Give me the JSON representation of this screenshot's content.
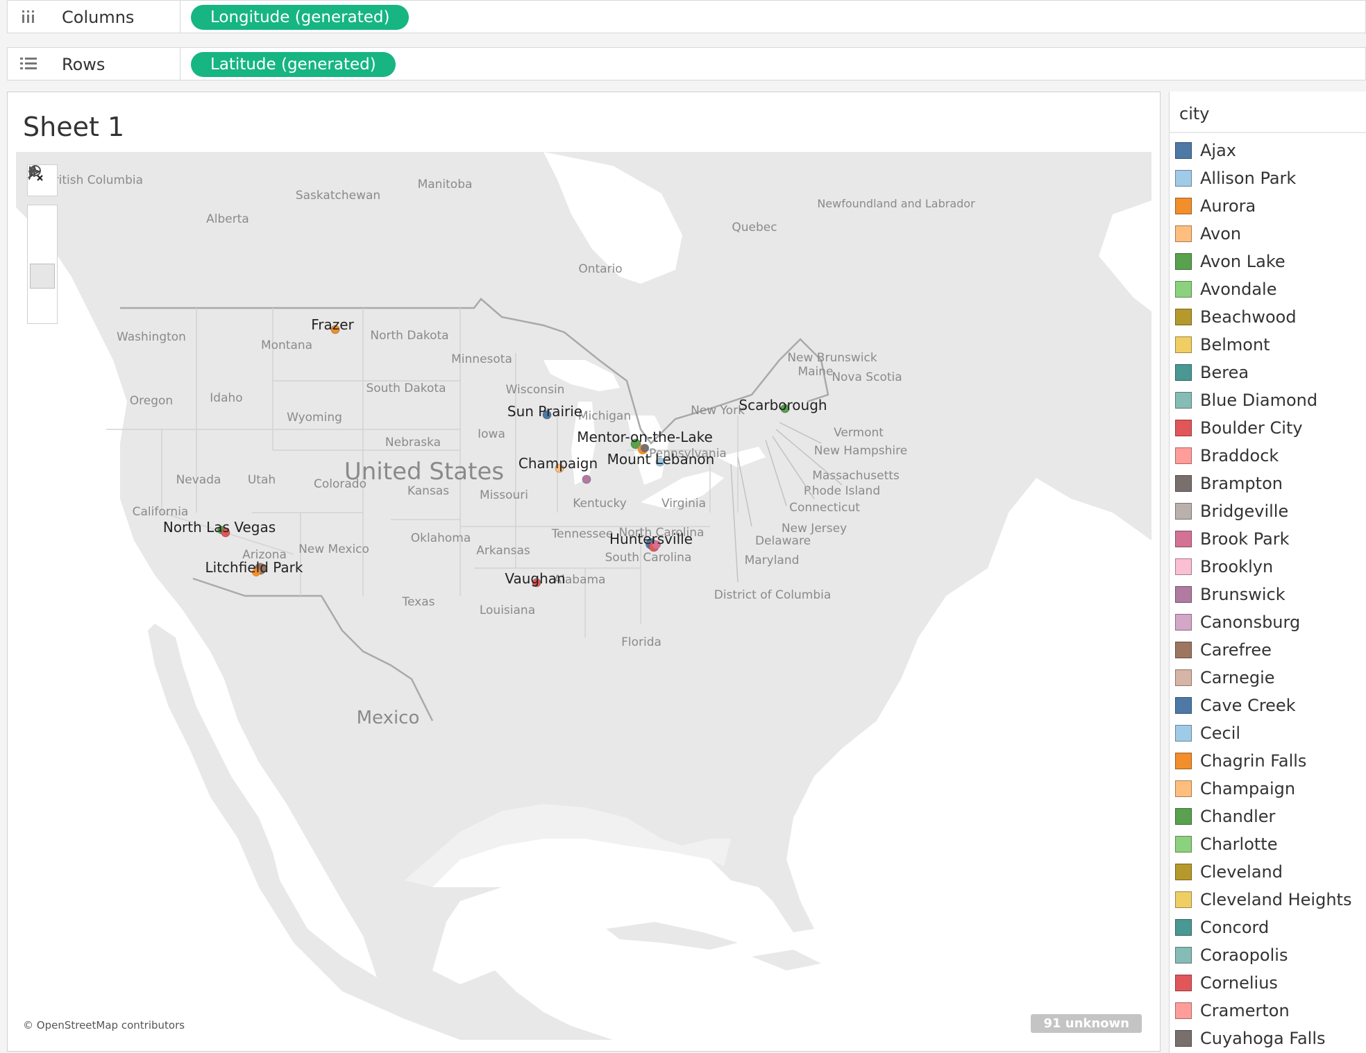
{
  "shelves": {
    "columns": {
      "label": "Columns",
      "pill": "Longitude (generated)"
    },
    "rows": {
      "label": "Rows",
      "pill": "Latitude (generated)"
    }
  },
  "sheet": {
    "title": "Sheet 1",
    "attribution": "© OpenStreetMap contributors",
    "unknown_badge": "91 unknown"
  },
  "map": {
    "region_labels": [
      "British Columbia",
      "Alberta",
      "Saskatchewan",
      "Manitoba",
      "Ontario",
      "Quebec",
      "Newfoundland and Labrador",
      "New Brunswick",
      "Nova Scotia",
      "Maine",
      "Washington",
      "Oregon",
      "Idaho",
      "Montana",
      "Wyoming",
      "North Dakota",
      "South Dakota",
      "Nebraska",
      "Kansas",
      "Minnesota",
      "Iowa",
      "Missouri",
      "Wisconsin",
      "Michigan",
      "Nevada",
      "Utah",
      "Colorado",
      "California",
      "Arizona",
      "New Mexico",
      "Oklahoma",
      "Texas",
      "Arkansas",
      "Louisiana",
      "Tennessee",
      "Kentucky",
      "Alabama",
      "Virginia",
      "North Carolina",
      "South Carolina",
      "Florida",
      "New York",
      "Pennsylvania",
      "Vermont",
      "New Hampshire",
      "Massachusetts",
      "Rhode Island",
      "Connecticut",
      "New Jersey",
      "Delaware",
      "Maryland",
      "District of Columbia",
      "United States",
      "Mexico"
    ],
    "city_markers": [
      {
        "label": "Frazer",
        "color": "#f28e2b"
      },
      {
        "label": "Sun Prairie",
        "color": "#4e79a7"
      },
      {
        "label": "Mentor-on-the-Lake",
        "color": "#59a14f"
      },
      {
        "label": "Mount Lebanon",
        "color": "#a0cbe8"
      },
      {
        "label": "Champaign",
        "color": "#ffbe7d"
      },
      {
        "label": "Scarborough",
        "color": "#59a14f"
      },
      {
        "label": "North Las Vegas",
        "color": "#e15759"
      },
      {
        "label": "Litchfield Park",
        "color": "#9d7660"
      },
      {
        "label": "Huntersville",
        "color": "#e15759"
      },
      {
        "label": "Vaughan",
        "color": "#e15759"
      }
    ],
    "unlabeled_markers": [
      {
        "color": "#b07aa1"
      }
    ]
  },
  "legend": {
    "title": "city",
    "items": [
      {
        "label": "Ajax",
        "color": "#4e79a7"
      },
      {
        "label": "Allison Park",
        "color": "#a0cbe8"
      },
      {
        "label": "Aurora",
        "color": "#f28e2b"
      },
      {
        "label": "Avon",
        "color": "#ffbe7d"
      },
      {
        "label": "Avon Lake",
        "color": "#59a14f"
      },
      {
        "label": "Avondale",
        "color": "#8cd17d"
      },
      {
        "label": "Beachwood",
        "color": "#b6992d"
      },
      {
        "label": "Belmont",
        "color": "#f1ce63"
      },
      {
        "label": "Berea",
        "color": "#499894"
      },
      {
        "label": "Blue Diamond",
        "color": "#86bcb6"
      },
      {
        "label": "Boulder City",
        "color": "#e15759"
      },
      {
        "label": "Braddock",
        "color": "#ff9d9a"
      },
      {
        "label": "Brampton",
        "color": "#79706e"
      },
      {
        "label": "Bridgeville",
        "color": "#bab0ac"
      },
      {
        "label": "Brook Park",
        "color": "#d37295"
      },
      {
        "label": "Brooklyn",
        "color": "#fabfd2"
      },
      {
        "label": "Brunswick",
        "color": "#b07aa1"
      },
      {
        "label": "Canonsburg",
        "color": "#d4a6c8"
      },
      {
        "label": "Carefree",
        "color": "#9d7660"
      },
      {
        "label": "Carnegie",
        "color": "#d7b5a6"
      },
      {
        "label": "Cave Creek",
        "color": "#4e79a7"
      },
      {
        "label": "Cecil",
        "color": "#a0cbe8"
      },
      {
        "label": "Chagrin Falls",
        "color": "#f28e2b"
      },
      {
        "label": "Champaign",
        "color": "#ffbe7d"
      },
      {
        "label": "Chandler",
        "color": "#59a14f"
      },
      {
        "label": "Charlotte",
        "color": "#8cd17d"
      },
      {
        "label": "Cleveland",
        "color": "#b6992d"
      },
      {
        "label": "Cleveland Heights",
        "color": "#f1ce63"
      },
      {
        "label": "Concord",
        "color": "#499894"
      },
      {
        "label": "Coraopolis",
        "color": "#86bcb6"
      },
      {
        "label": "Cornelius",
        "color": "#e15759"
      },
      {
        "label": "Cramerton",
        "color": "#ff9d9a"
      },
      {
        "label": "Cuyahoga Falls",
        "color": "#79706e"
      }
    ]
  }
}
